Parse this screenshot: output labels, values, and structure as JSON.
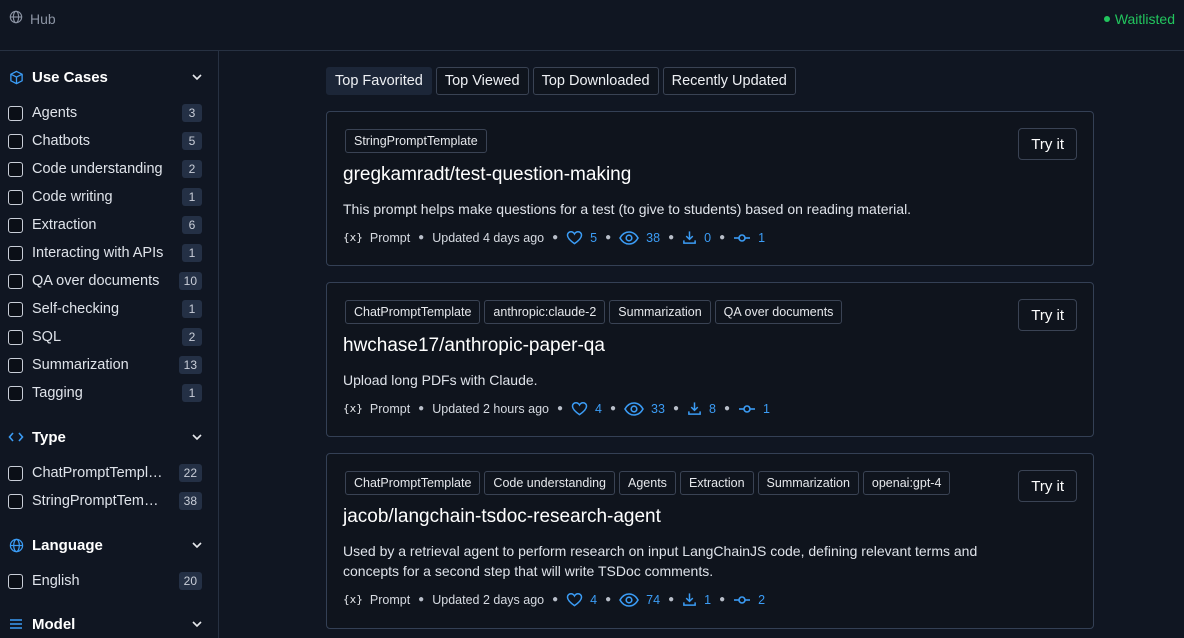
{
  "topbar": {
    "hub_label": "Hub",
    "status": "Waitlisted"
  },
  "sidebar": {
    "use_cases": {
      "title": "Use Cases",
      "items": [
        {
          "label": "Agents",
          "count": "3"
        },
        {
          "label": "Chatbots",
          "count": "5"
        },
        {
          "label": "Code understanding",
          "count": "2"
        },
        {
          "label": "Code writing",
          "count": "1"
        },
        {
          "label": "Extraction",
          "count": "6"
        },
        {
          "label": "Interacting with APIs",
          "count": "1"
        },
        {
          "label": "QA over documents",
          "count": "10"
        },
        {
          "label": "Self-checking",
          "count": "1"
        },
        {
          "label": "SQL",
          "count": "2"
        },
        {
          "label": "Summarization",
          "count": "13"
        },
        {
          "label": "Tagging",
          "count": "1"
        }
      ]
    },
    "type": {
      "title": "Type",
      "items": [
        {
          "label": "ChatPromptTempl…",
          "count": "22"
        },
        {
          "label": "StringPromptTem…",
          "count": "38"
        }
      ]
    },
    "language": {
      "title": "Language",
      "items": [
        {
          "label": "English",
          "count": "20"
        }
      ]
    },
    "model": {
      "title": "Model"
    }
  },
  "tabs": [
    "Top Favorited",
    "Top Viewed",
    "Top Downloaded",
    "Recently Updated"
  ],
  "cards": [
    {
      "tags": [
        "StringPromptTemplate"
      ],
      "title": "gregkamradt/test-question-making",
      "description": "This prompt helps make questions for a test (to give to students) based on reading material.",
      "kind": "Prompt",
      "updated": "Updated 4 days ago",
      "likes": "5",
      "views": "38",
      "downloads": "0",
      "commits": "1",
      "try_label": "Try it"
    },
    {
      "tags": [
        "ChatPromptTemplate",
        "anthropic:claude-2",
        "Summarization",
        "QA over documents"
      ],
      "title": "hwchase17/anthropic-paper-qa",
      "description": "Upload long PDFs with Claude.",
      "kind": "Prompt",
      "updated": "Updated 2 hours ago",
      "likes": "4",
      "views": "33",
      "downloads": "8",
      "commits": "1",
      "try_label": "Try it"
    },
    {
      "tags": [
        "ChatPromptTemplate",
        "Code understanding",
        "Agents",
        "Extraction",
        "Summarization",
        "openai:gpt-4"
      ],
      "title": "jacob/langchain-tsdoc-research-agent",
      "description": "Used by a retrieval agent to perform research on input LangChainJS code, defining relevant terms and concepts for a second step that will write TSDoc comments.",
      "kind": "Prompt",
      "updated": "Updated 2 days ago",
      "likes": "4",
      "views": "74",
      "downloads": "1",
      "commits": "2",
      "try_label": "Try it"
    }
  ],
  "colors": {
    "accent": "#3b9cf5",
    "status": "#22c55e",
    "background": "#101622"
  },
  "icons": {
    "hub": "globe-icon",
    "use_cases": "cube-icon",
    "type": "code-icon",
    "language": "globe-icon",
    "model": "list-icon"
  }
}
